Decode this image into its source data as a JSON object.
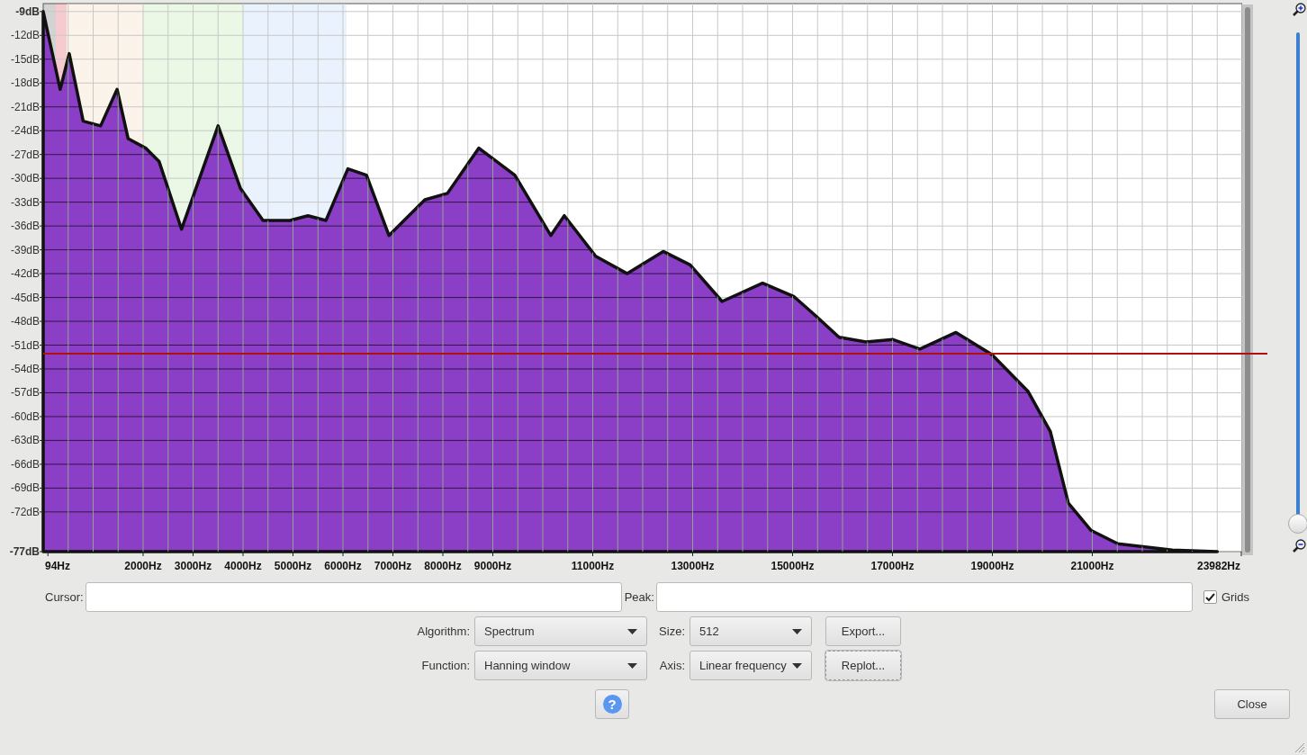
{
  "chart": {
    "chart_data": {
      "type": "area",
      "grid": true,
      "xlim": [
        0,
        24000
      ],
      "ylim": [
        -77,
        -8
      ],
      "x": [
        0,
        0,
        340,
        520,
        800,
        1150,
        1480,
        1700,
        2050,
        2320,
        2770,
        3500,
        3950,
        4400,
        4940,
        5300,
        5660,
        6100,
        6470,
        6920,
        7640,
        8090,
        8720,
        9440,
        10160,
        10430,
        11060,
        11690,
        12410,
        12950,
        13590,
        14400,
        15030,
        15480,
        15930,
        16470,
        17010,
        17550,
        18270,
        18990,
        19710,
        20160,
        20520,
        20970,
        21510,
        22600,
        23500
      ],
      "series": [
        {
          "color": "#8b3fc6",
          "values": [
            -77,
            -9,
            -18.8,
            -14.3,
            -22.8,
            -23.4,
            -18.8,
            -25,
            -26.2,
            -27.9,
            -36.4,
            -23.4,
            -31.3,
            -35.3,
            -35.3,
            -34.7,
            -35.3,
            -28.8,
            -29.6,
            -37.2,
            -32.7,
            -31.9,
            -26.2,
            -29.6,
            -37.2,
            -34.7,
            -39.8,
            -42,
            -39.2,
            -40.9,
            -45.5,
            -43.2,
            -44.9,
            -47.4,
            -50,
            -50.6,
            -50.3,
            -51.5,
            -49.4,
            -52.2,
            -56.8,
            -61.9,
            -70.9,
            -74.3,
            -76,
            -76.8,
            -77
          ]
        }
      ],
      "xticks": [
        {
          "value": 94,
          "label": "94Hz"
        },
        {
          "value": 2000,
          "label": "2000Hz"
        },
        {
          "value": 3000,
          "label": "3000Hz"
        },
        {
          "value": 4000,
          "label": "4000Hz"
        },
        {
          "value": 5000,
          "label": "5000Hz"
        },
        {
          "value": 6000,
          "label": "6000Hz"
        },
        {
          "value": 7000,
          "label": "7000Hz"
        },
        {
          "value": 8000,
          "label": "8000Hz"
        },
        {
          "value": 9000,
          "label": "9000Hz"
        },
        {
          "value": 11000,
          "label": "11000Hz"
        },
        {
          "value": 13000,
          "label": "13000Hz"
        },
        {
          "value": 15000,
          "label": "15000Hz"
        },
        {
          "value": 17000,
          "label": "17000Hz"
        },
        {
          "value": 19000,
          "label": "19000Hz"
        },
        {
          "value": 21000,
          "label": "21000Hz"
        },
        {
          "value": 23982,
          "label": "23982Hz"
        }
      ],
      "yticks": [
        {
          "value": -9,
          "label": "-9dB"
        },
        {
          "value": -12,
          "label": "-12dB"
        },
        {
          "value": -15,
          "label": "-15dB"
        },
        {
          "value": -18,
          "label": "-18dB"
        },
        {
          "value": -21,
          "label": "-21dB"
        },
        {
          "value": -24,
          "label": "-24dB"
        },
        {
          "value": -27,
          "label": "-27dB"
        },
        {
          "value": -30,
          "label": "-30dB"
        },
        {
          "value": -33,
          "label": "-33dB"
        },
        {
          "value": -36,
          "label": "-36dB"
        },
        {
          "value": -39,
          "label": "-39dB"
        },
        {
          "value": -42,
          "label": "-42dB"
        },
        {
          "value": -45,
          "label": "-45dB"
        },
        {
          "value": -48,
          "label": "-48dB"
        },
        {
          "value": -51,
          "label": "-51dB"
        },
        {
          "value": -54,
          "label": "-54dB"
        },
        {
          "value": -57,
          "label": "-57dB"
        },
        {
          "value": -60,
          "label": "-60dB"
        },
        {
          "value": -63,
          "label": "-63dB"
        },
        {
          "value": -66,
          "label": "-66dB"
        },
        {
          "value": -69,
          "label": "-69dB"
        },
        {
          "value": -72,
          "label": "-72dB"
        },
        {
          "value": -77,
          "label": "-77dB"
        }
      ]
    }
  },
  "zoom_slider": {
    "level": 0
  },
  "cursor": {
    "label": "Cursor:"
  },
  "peak": {
    "label": "Peak:"
  },
  "grids": {
    "label": "Grids",
    "checked": true
  },
  "algorithm": {
    "label": "Algorithm:",
    "value": "Spectrum"
  },
  "size": {
    "label": "Size:",
    "value": "512"
  },
  "export_button": {
    "label": "Export..."
  },
  "function": {
    "label": "Function:",
    "value": "Hanning window"
  },
  "axis": {
    "label": "Axis:",
    "value": "Linear frequency"
  },
  "replot_button": {
    "label": "Replot..."
  },
  "help_button": {
    "label": "?"
  },
  "close_button": {
    "label": "Close"
  }
}
